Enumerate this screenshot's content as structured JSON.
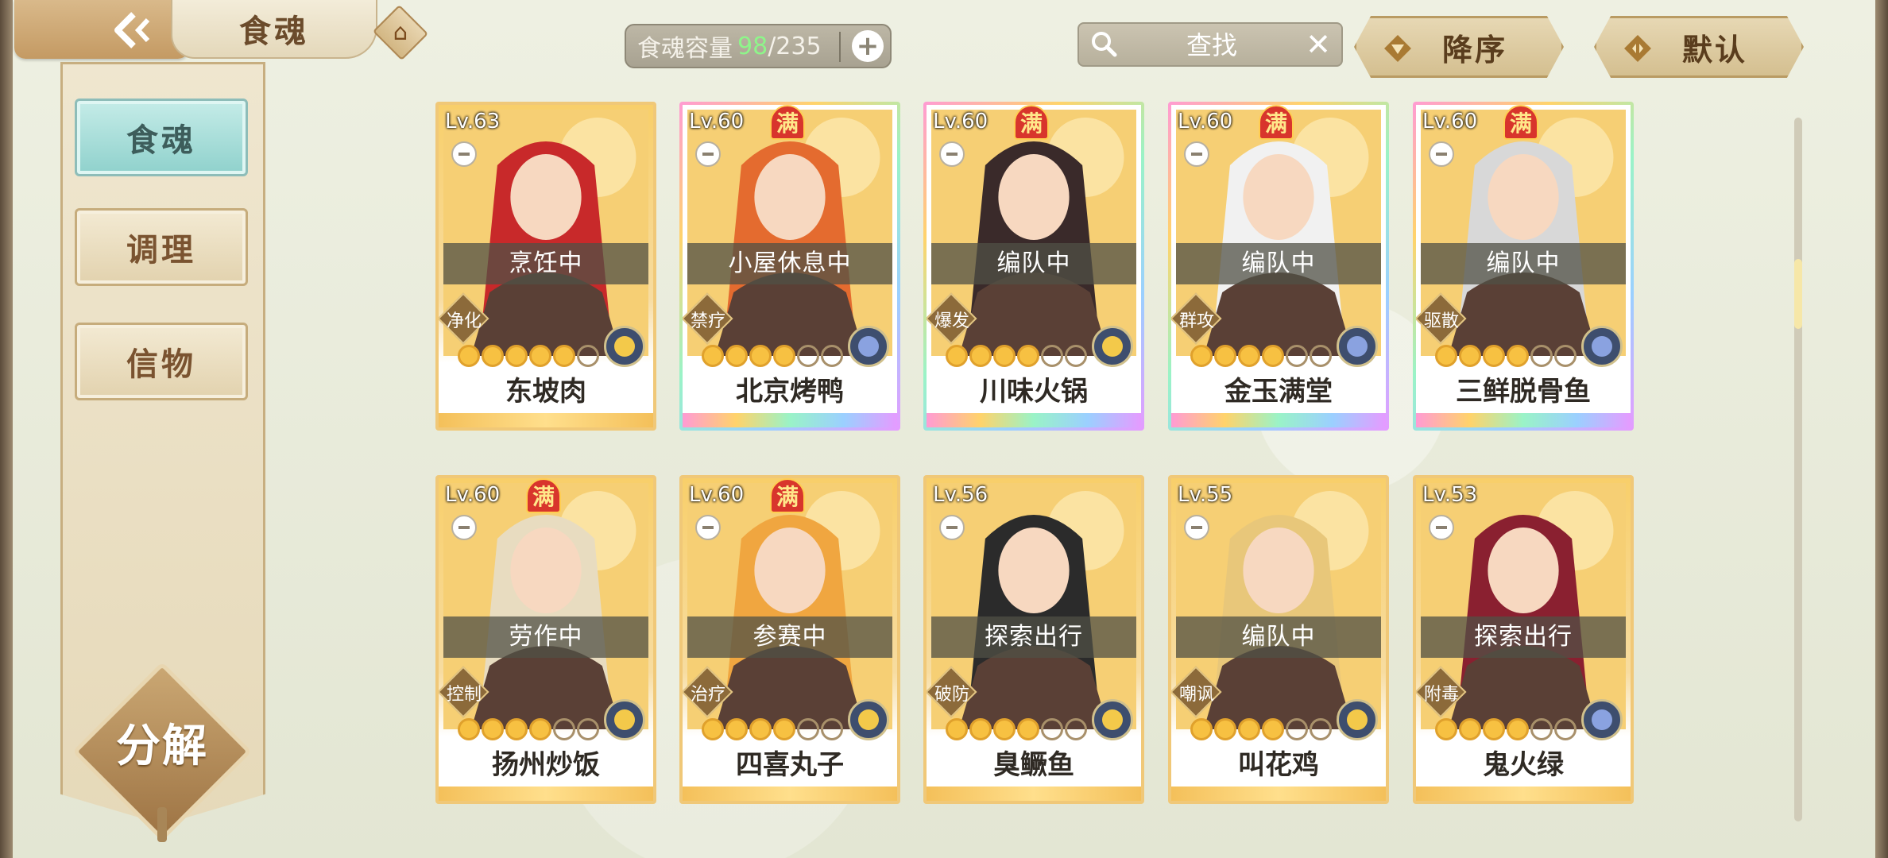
{
  "header": {
    "title": "食魂",
    "capacity_label": "食魂容量",
    "capacity_current": "98",
    "capacity_total": "/235",
    "search_placeholder": "查找",
    "sort_order_label": "降序",
    "sort_mode_label": "默认"
  },
  "sidebar": {
    "items": [
      {
        "label": "食魂",
        "active": true
      },
      {
        "label": "调理",
        "active": false
      },
      {
        "label": "信物",
        "active": false
      }
    ],
    "decompose_label": "分解"
  },
  "colors": {
    "accent_teal": "#8fd1cc",
    "capacity_green": "#8ef58a",
    "full_badge": "#d8352c"
  },
  "cards": [
    {
      "level": "Lv.63",
      "full": false,
      "status": "烹饪中",
      "role": "净化",
      "stars": 5,
      "element": "gold",
      "name": "东坡肉",
      "rainbow": false
    },
    {
      "level": "Lv.60",
      "full": true,
      "full_label": "满",
      "status": "小屋休息中",
      "role": "禁疗",
      "stars": 4,
      "element": "blue",
      "name": "北京烤鸭",
      "rainbow": true
    },
    {
      "level": "Lv.60",
      "full": true,
      "full_label": "满",
      "status": "编队中",
      "role": "爆发",
      "stars": 4,
      "element": "gold",
      "name": "川味火锅",
      "rainbow": true
    },
    {
      "level": "Lv.60",
      "full": true,
      "full_label": "满",
      "status": "编队中",
      "role": "群攻",
      "stars": 4,
      "element": "blue",
      "name": "金玉满堂",
      "rainbow": true
    },
    {
      "level": "Lv.60",
      "full": true,
      "full_label": "满",
      "status": "编队中",
      "role": "驱散",
      "stars": 4,
      "element": "blue",
      "name": "三鲜脱骨鱼",
      "rainbow": true
    },
    {
      "level": "Lv.60",
      "full": true,
      "full_label": "满",
      "status": "劳作中",
      "role": "控制",
      "stars": 4,
      "element": "gold",
      "name": "扬州炒饭",
      "rainbow": false
    },
    {
      "level": "Lv.60",
      "full": true,
      "full_label": "满",
      "status": "参赛中",
      "role": "治疗",
      "stars": 4,
      "element": "gold",
      "name": "四喜丸子",
      "rainbow": false
    },
    {
      "level": "Lv.56",
      "full": false,
      "status": "探索出行",
      "role": "破防",
      "stars": 4,
      "element": "gold",
      "name": "臭鳜鱼",
      "rainbow": false
    },
    {
      "level": "Lv.55",
      "full": false,
      "status": "编队中",
      "role": "嘲讽",
      "stars": 4,
      "element": "gold",
      "name": "叫花鸡",
      "rainbow": false
    },
    {
      "level": "Lv.53",
      "full": false,
      "status": "探索出行",
      "role": "附毒",
      "stars": 4,
      "element": "blue",
      "name": "鬼火绿",
      "rainbow": false
    }
  ]
}
